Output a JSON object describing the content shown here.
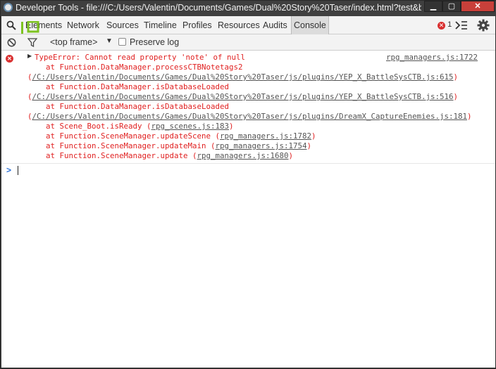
{
  "window": {
    "title": "Developer Tools - file:///C:/Users/Valentin/Documents/Games/Dual%20Story%20Taser/index.html?test&bt...",
    "min_label": "▁",
    "max_label": "▢",
    "close_label": "✕"
  },
  "tabs": [
    {
      "label": "Elements"
    },
    {
      "label": "Network"
    },
    {
      "label": "Sources"
    },
    {
      "label": "Timeline"
    },
    {
      "label": "Profiles"
    },
    {
      "label": "Resources"
    },
    {
      "label": "Audits"
    },
    {
      "label": "Console"
    }
  ],
  "toolbar": {
    "error_count": "1",
    "frame_selector": "<top frame>",
    "preserve_log_label": "Preserve log",
    "preserve_log_checked": false
  },
  "console": {
    "error_message": "TypeError: Cannot read property 'note' of null",
    "error_source": "rpg_managers.js:1722",
    "stack": [
      {
        "text": "    at Function.DataManager.processCTBNotetags2"
      },
      {
        "text": "(",
        "link": "/C:/Users/Valentin/Documents/Games/Dual%20Story%20Taser/js/plugins/YEP_X_BattleSysCTB.js:615",
        "tail": ")"
      },
      {
        "text": "    at Function.DataManager.isDatabaseLoaded"
      },
      {
        "text": "(",
        "link": "/C:/Users/Valentin/Documents/Games/Dual%20Story%20Taser/js/plugins/YEP_X_BattleSysCTB.js:516",
        "tail": ")"
      },
      {
        "text": "    at Function.DataManager.isDatabaseLoaded"
      },
      {
        "text": "(",
        "link": "/C:/Users/Valentin/Documents/Games/Dual%20Story%20Taser/js/plugins/DreamX_CaptureEnemies.js:181",
        "tail": ")"
      },
      {
        "text": "    at Scene_Boot.isReady (",
        "link": "rpg_scenes.js:183",
        "tail": ")"
      },
      {
        "text": "    at Function.SceneManager.updateScene (",
        "link": "rpg_managers.js:1782",
        "tail": ")"
      },
      {
        "text": "    at Function.SceneManager.updateMain (",
        "link": "rpg_managers.js:1754",
        "tail": ")"
      },
      {
        "text": "    at Function.SceneManager.update (",
        "link": "rpg_managers.js:1680",
        "tail": ")"
      }
    ],
    "prompt_symbol": ">"
  },
  "colors": {
    "error_red": "#e02020",
    "prompt_blue": "#2a6fd6",
    "inspect_green": "#7ec320"
  }
}
